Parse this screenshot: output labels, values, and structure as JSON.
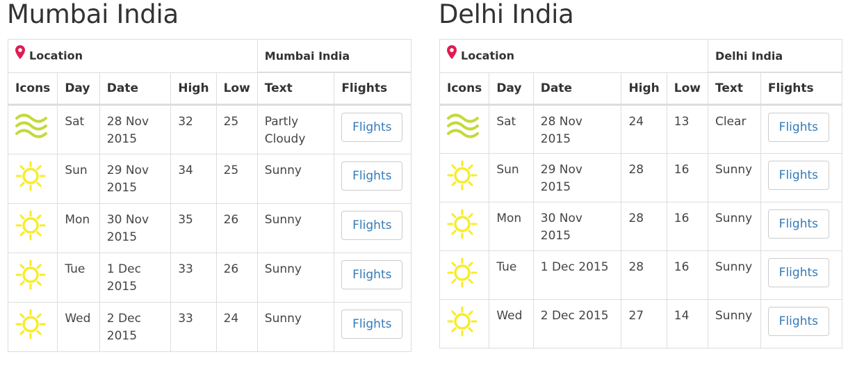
{
  "colors": {
    "link": "#337ab7",
    "sun": "#f7ec2a",
    "wind": "#c4d93a",
    "pin": "#e21a53"
  },
  "icons": {
    "location": "map-pin-icon",
    "sunny": "sun-icon",
    "partly": "wind-icon"
  },
  "headers": {
    "location": "Location",
    "icons": "Icons",
    "day": "Day",
    "date": "Date",
    "high": "High",
    "low": "Low",
    "text": "Text",
    "flights": "Flights"
  },
  "cities": [
    {
      "title": "Mumbai India",
      "location_value": "Mumbai India",
      "rows": [
        {
          "icon": "wind-icon",
          "day": "Sat",
          "date": "28 Nov 2015",
          "high": "32",
          "low": "25",
          "text": "Partly Cloudy",
          "button": "Flights"
        },
        {
          "icon": "sun-icon",
          "day": "Sun",
          "date": "29 Nov 2015",
          "high": "34",
          "low": "25",
          "text": "Sunny",
          "button": "Flights"
        },
        {
          "icon": "sun-icon",
          "day": "Mon",
          "date": "30 Nov 2015",
          "high": "35",
          "low": "26",
          "text": "Sunny",
          "button": "Flights"
        },
        {
          "icon": "sun-icon",
          "day": "Tue",
          "date": "1 Dec 2015",
          "high": "33",
          "low": "26",
          "text": "Sunny",
          "button": "Flights"
        },
        {
          "icon": "sun-icon",
          "day": "Wed",
          "date": "2 Dec 2015",
          "high": "33",
          "low": "24",
          "text": "Sunny",
          "button": "Flights"
        }
      ]
    },
    {
      "title": "Delhi India",
      "location_value": "Delhi India",
      "rows": [
        {
          "icon": "wind-icon",
          "day": "Sat",
          "date": "28 Nov 2015",
          "high": "24",
          "low": "13",
          "text": "Clear",
          "button": "Flights"
        },
        {
          "icon": "sun-icon",
          "day": "Sun",
          "date": "29 Nov 2015",
          "high": "28",
          "low": "16",
          "text": "Sunny",
          "button": "Flights"
        },
        {
          "icon": "sun-icon",
          "day": "Mon",
          "date": "30 Nov 2015",
          "high": "28",
          "low": "16",
          "text": "Sunny",
          "button": "Flights"
        },
        {
          "icon": "sun-icon",
          "day": "Tue",
          "date": "1 Dec 2015",
          "high": "28",
          "low": "16",
          "text": "Sunny",
          "button": "Flights"
        },
        {
          "icon": "sun-icon",
          "day": "Wed",
          "date": "2 Dec 2015",
          "high": "27",
          "low": "14",
          "text": "Sunny",
          "button": "Flights"
        }
      ]
    }
  ]
}
